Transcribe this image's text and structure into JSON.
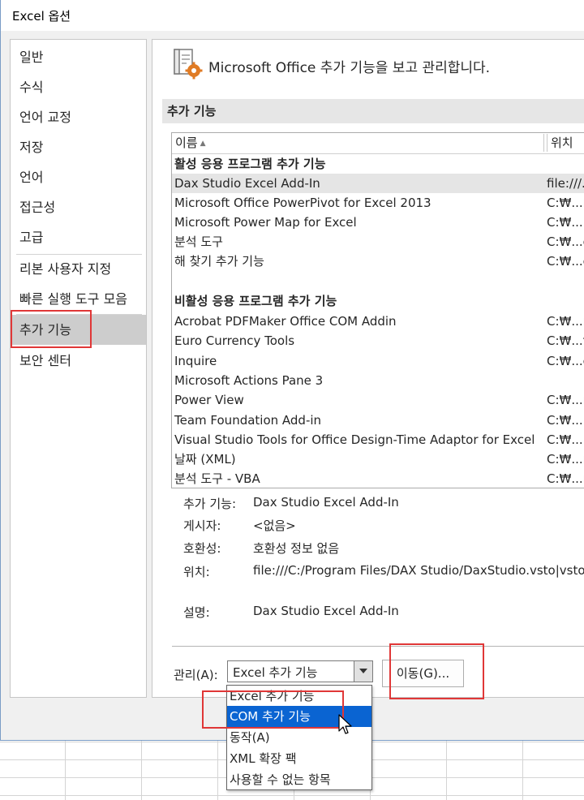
{
  "window": {
    "title": "Excel 옵션"
  },
  "nav": {
    "items": [
      {
        "label": "일반"
      },
      {
        "label": "수식"
      },
      {
        "label": "언어 교정"
      },
      {
        "label": "저장"
      },
      {
        "label": "언어"
      },
      {
        "label": "접근성"
      },
      {
        "label": "고급"
      },
      {
        "label": "리본 사용자 지정"
      },
      {
        "label": "빠른 실행 도구 모음"
      },
      {
        "label": "추가 기능"
      },
      {
        "label": "보안 센터"
      }
    ],
    "selected": "추가 기능"
  },
  "header": {
    "text": "Microsoft Office 추가 기능을 보고 관리합니다.",
    "icon": "addins-gear-icon"
  },
  "section": {
    "title": "추가 기능"
  },
  "table": {
    "columns": {
      "name": "이름",
      "location": "위치"
    },
    "groups": [
      {
        "title": "활성 응용 프로그램 추가 기능",
        "rows": [
          {
            "name": "Dax Studio Excel Add-In",
            "location": "file:///..."
          },
          {
            "name": "Microsoft Office PowerPivot for Excel 2013",
            "location": "C:₩...rP"
          },
          {
            "name": "Microsoft Power Map for Excel",
            "location": "C:₩...Po"
          },
          {
            "name": "분석 도구",
            "location": "C:₩...e"
          },
          {
            "name": "해 찾기 추가 기능",
            "location": "C:₩...e"
          }
        ]
      },
      {
        "title": "비활성 응용 프로그램 추가 기능",
        "rows": [
          {
            "name": "Acrobat PDFMaker Office COM Addin",
            "location": "C:₩...ro"
          },
          {
            "name": "Euro Currency Tools",
            "location": "C:₩...t"
          },
          {
            "name": "Inquire",
            "location": "C:₩...cr"
          },
          {
            "name": "Microsoft Actions Pane 3",
            "location": ""
          },
          {
            "name": "Power View",
            "location": "C:₩...r"
          },
          {
            "name": "Team Foundation Add-in",
            "location": "C:₩... F"
          },
          {
            "name": "Visual Studio Tools for Office Design-Time Adaptor for Excel",
            "location": "C:₩...l"
          },
          {
            "name": "날짜 (XML)",
            "location": "C:₩...m"
          },
          {
            "name": "분석 도구 - VBA",
            "location": "C:₩...ro"
          }
        ]
      }
    ]
  },
  "details": {
    "addin_label": "추가 기능:",
    "addin_value": "Dax Studio Excel Add-In",
    "publisher_label": "게시자:",
    "publisher_value": "<없음>",
    "compat_label": "호환성:",
    "compat_value": "호환성 정보 없음",
    "location_label": "위치:",
    "location_value": "file:///C:/Program Files/DAX Studio/DaxStudio.vsto|vstol",
    "desc_label": "설명:",
    "desc_value": "Dax Studio Excel Add-In"
  },
  "manage": {
    "label": "관리(A):",
    "selected": "Excel 추가 기능",
    "go_button": "이동(G)...",
    "options": [
      "Excel 추가 기능",
      "COM 추가 기능",
      "동작(A)",
      "XML 확장 팩",
      "사용할 수 없는 항목"
    ],
    "highlighted_option": "COM 추가 기능"
  },
  "colors": {
    "highlight_box": "#e03737",
    "dropdown_selection": "#0a64d2"
  }
}
